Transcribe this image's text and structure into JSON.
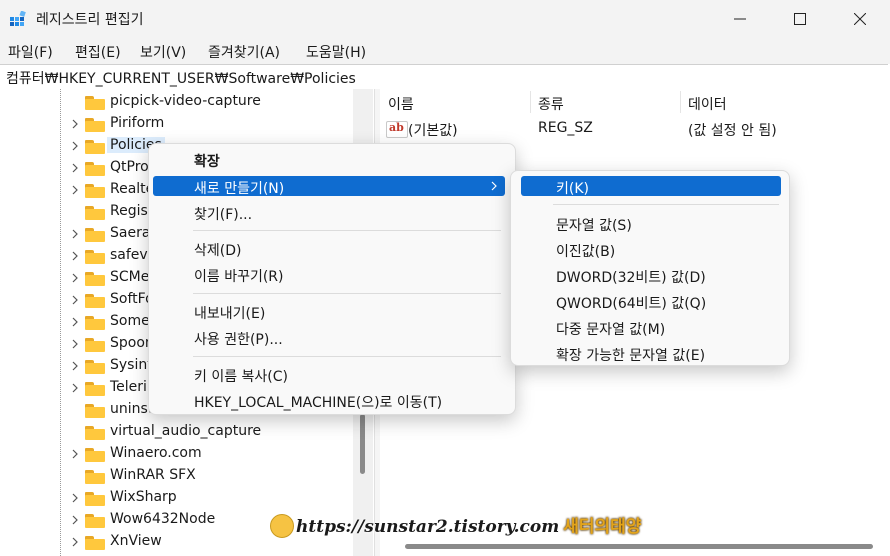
{
  "window": {
    "title": "레지스트리 편집기"
  },
  "menu": [
    "파일(F)",
    "편집(E)",
    "보기(V)",
    "즐겨찾기(A)",
    "도움말(H)"
  ],
  "address": "컴퓨터₩HKEY_CURRENT_USER₩Software₩Policies",
  "tree_items": [
    {
      "label": "picpick-video-capture",
      "expandable": false
    },
    {
      "label": "Piriform",
      "expandable": true
    },
    {
      "label": "Policies",
      "expandable": true,
      "selected": true
    },
    {
      "label": "QtProject",
      "expandable": true
    },
    {
      "label": "Realtek",
      "expandable": true
    },
    {
      "label": "RegisteredApplications",
      "expandable": false
    },
    {
      "label": "Saera",
      "expandable": true
    },
    {
      "label": "safevi",
      "expandable": true
    },
    {
      "label": "SCMe",
      "expandable": true
    },
    {
      "label": "SoftFo",
      "expandable": true
    },
    {
      "label": "Some",
      "expandable": true
    },
    {
      "label": "Spoon",
      "expandable": true
    },
    {
      "label": "Sysint",
      "expandable": true
    },
    {
      "label": "Teleri",
      "expandable": true
    },
    {
      "label": "uninstallable",
      "expandable": false
    },
    {
      "label": "virtual_audio_capture",
      "expandable": false
    },
    {
      "label": "Winaero.com",
      "expandable": true
    },
    {
      "label": "WinRAR SFX",
      "expandable": false
    },
    {
      "label": "WixSharp",
      "expandable": true
    },
    {
      "label": "Wow6432Node",
      "expandable": true
    },
    {
      "label": "XnView",
      "expandable": true
    }
  ],
  "list": {
    "headers": [
      "이름",
      "종류",
      "데이터"
    ],
    "rows": [
      {
        "name": "(기본값)",
        "type": "REG_SZ",
        "data": "(값 설정 안 됨)",
        "icon": "ab-string-icon"
      }
    ]
  },
  "context_menu": {
    "items": [
      "확장",
      "새로 만들기(N)",
      "찾기(F)...",
      "삭제(D)",
      "이름 바꾸기(R)",
      "내보내기(E)",
      "사용 권한(P)...",
      "키 이름 복사(C)",
      "HKEY_LOCAL_MACHINE(으)로 이동(T)"
    ],
    "active_item": "새로 만들기(N)"
  },
  "submenu": {
    "items": [
      "키(K)",
      "문자열 값(S)",
      "이진값(B)",
      "DWORD(32비트) 값(D)",
      "QWORD(64비트) 값(Q)",
      "다중 문자열 값(M)",
      "확장 가능한 문자열 값(E)"
    ],
    "active_item": "키(K)"
  },
  "watermark": {
    "url": "https://sunstar2.tistory.com",
    "brand": "새터의태양"
  },
  "colors": {
    "accent": "#0f6cd0",
    "folder": "#ffc83d",
    "selection": "#dcecfc"
  }
}
